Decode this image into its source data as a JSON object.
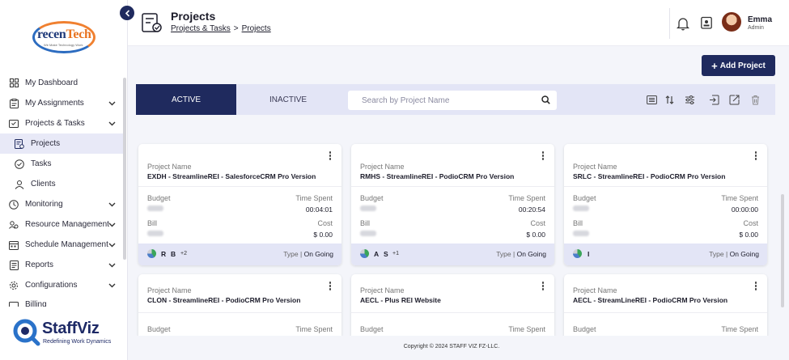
{
  "logo": {
    "text_main": "recen",
    "text_accent": "Tech",
    "tagline": "We Make Technology Work"
  },
  "sidebar": {
    "items": [
      {
        "label": "My Dashboard",
        "icon": "dashboard-icon",
        "expandable": false
      },
      {
        "label": "My Assignments",
        "icon": "assignments-icon",
        "expandable": true
      },
      {
        "label": "Projects & Tasks",
        "icon": "projects-tasks-icon",
        "expandable": true
      },
      {
        "label": "Projects",
        "icon": "projects-icon",
        "expandable": false,
        "active": true
      },
      {
        "label": "Tasks",
        "icon": "tasks-icon",
        "expandable": false
      },
      {
        "label": "Clients",
        "icon": "clients-icon",
        "expandable": false
      },
      {
        "label": "Monitoring",
        "icon": "monitoring-icon",
        "expandable": true
      },
      {
        "label": "Resource Management",
        "icon": "resource-icon",
        "expandable": true
      },
      {
        "label": "Schedule Management",
        "icon": "schedule-icon",
        "expandable": true
      },
      {
        "label": "Reports",
        "icon": "reports-icon",
        "expandable": true
      },
      {
        "label": "Configurations",
        "icon": "gear-icon",
        "expandable": true
      },
      {
        "label": "Billing",
        "icon": "billing-icon",
        "expandable": true
      }
    ]
  },
  "brand": {
    "name": "StaffViz",
    "tagline": "Redefining Work Dynamics"
  },
  "header": {
    "title": "Projects",
    "breadcrumb": [
      "Projects & Tasks",
      "Projects"
    ],
    "breadcrumb_sep": ">",
    "user_name": "Emma",
    "user_role": "Admin"
  },
  "add_button": {
    "plus": "+",
    "label": "Add Project"
  },
  "toolbar": {
    "tabs": {
      "active": "ACTIVE",
      "inactive": "INACTIVE"
    },
    "search_placeholder": "Search by Project Name"
  },
  "card_labels": {
    "project_name": "Project Name",
    "budget": "Budget",
    "time_spent": "Time Spent",
    "bill": "Bill",
    "cost": "Cost",
    "type": "Type",
    "type_sep": "|"
  },
  "cards": [
    {
      "name": "EXDH - StreamlineREI - SalesforceCRM Pro Version",
      "time_spent": "00:04:01",
      "cost": "$ 0.00",
      "initials": [
        "R",
        "B"
      ],
      "more": "+2",
      "status": "On Going"
    },
    {
      "name": "RMHS - StreamlineREI - PodioCRM Pro Version",
      "time_spent": "00:20:54",
      "cost": "$ 0.00",
      "initials": [
        "A",
        "S"
      ],
      "more": "+1",
      "status": "On Going"
    },
    {
      "name": "SRLC - StreamlineREI - PodioCRM Pro Version",
      "time_spent": "00:00:00",
      "cost": "$ 0.00",
      "initials": [
        "I"
      ],
      "more": "",
      "status": "On Going"
    },
    {
      "name": "CLON - StreamlineREI - PodioCRM Pro Version"
    },
    {
      "name": "AECL - Plus REI Website"
    },
    {
      "name": "AECL - StreamLineREI - PodioCRM Pro Version"
    }
  ],
  "footer": {
    "copyright": "Copyright © 2024 STAFF VIZ FZ-LLC."
  },
  "colors": {
    "primary": "#1f2a5e",
    "toolbar_bg": "#e3e5f6",
    "accent_orange": "#e8731f"
  }
}
